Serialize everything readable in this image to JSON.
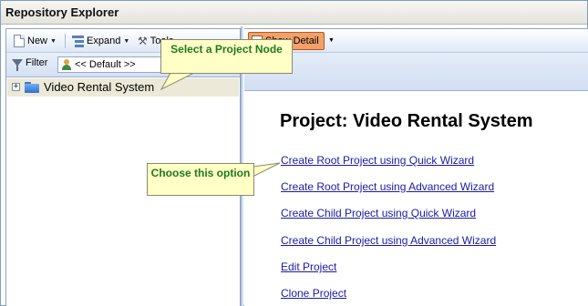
{
  "window": {
    "title": "Repository Explorer"
  },
  "left_panel": {
    "toolbar": {
      "new_label": "New",
      "expand_label": "Expand",
      "tools_label": "Tools"
    },
    "filter": {
      "label": "Filter",
      "selected": "<< Default >>"
    },
    "tree": [
      {
        "label": "Video Rental System",
        "icon": "folder-icon",
        "expander": "+"
      }
    ]
  },
  "right_panel": {
    "toolbar": {
      "show_detail_label": "Show Detail"
    },
    "heading": "Project: Video Rental System",
    "links": [
      "Create Root Project using Quick Wizard",
      "Create Root Project using Advanced Wizard",
      "Create Child Project using Quick Wizard",
      "Create Child Project using Advanced Wizard",
      "Edit Project",
      "Clone Project"
    ]
  },
  "callouts": {
    "select": "Select a Project Node",
    "choose": "Choose this option"
  },
  "colors": {
    "link": "#1a1aa6",
    "callout_bg": "#ffffc6",
    "callout_text": "#1f7a1f",
    "show_detail_bg": "#f3a06a",
    "selected_row": "#ece9d8"
  }
}
